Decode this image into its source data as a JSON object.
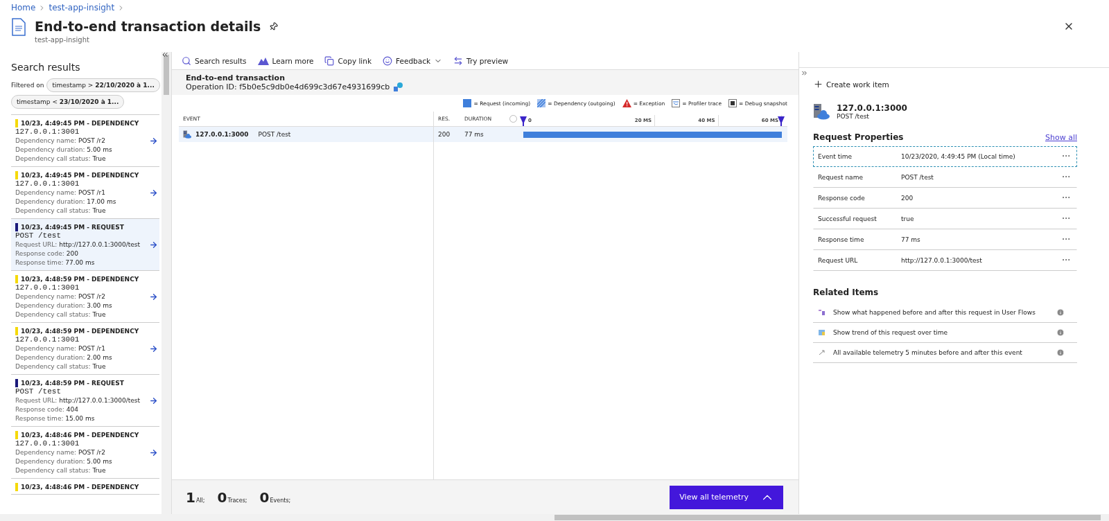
{
  "breadcrumb": [
    "Home",
    "test-app-insight"
  ],
  "title": "End-to-end transaction details",
  "subtitle": "test-app-insight",
  "search_panel": {
    "title": "Search results",
    "filter_label": "Filtered on",
    "filters": [
      {
        "field": "timestamp",
        "op": ">",
        "value": "22/10/2020 à 1..."
      },
      {
        "field": "timestamp",
        "op": "<",
        "value": "23/10/2020 à 1..."
      }
    ],
    "results": [
      {
        "kind": "dependency",
        "selected": false,
        "heading": "10/23, 4:49:45 PM - DEPENDENCY",
        "host": "127.0.0.1:3001",
        "props": [
          [
            "Dependency name:",
            "POST /r2"
          ],
          [
            "Dependency duration:",
            "5.00 ms"
          ],
          [
            "Dependency call status:",
            "True"
          ]
        ]
      },
      {
        "kind": "dependency",
        "selected": false,
        "heading": "10/23, 4:49:45 PM - DEPENDENCY",
        "host": "127.0.0.1:3001",
        "props": [
          [
            "Dependency name:",
            "POST /r1"
          ],
          [
            "Dependency duration:",
            "17.00 ms"
          ],
          [
            "Dependency call status:",
            "True"
          ]
        ]
      },
      {
        "kind": "request",
        "selected": true,
        "heading": "10/23, 4:49:45 PM - REQUEST",
        "host": "POST /test",
        "props": [
          [
            "Request URL:",
            "http://127.0.0.1:3000/test"
          ],
          [
            "Response code:",
            "200"
          ],
          [
            "Response time:",
            "77.00 ms"
          ]
        ]
      },
      {
        "kind": "dependency",
        "selected": false,
        "heading": "10/23, 4:48:59 PM - DEPENDENCY",
        "host": "127.0.0.1:3001",
        "props": [
          [
            "Dependency name:",
            "POST /r2"
          ],
          [
            "Dependency duration:",
            "3.00 ms"
          ],
          [
            "Dependency call status:",
            "True"
          ]
        ]
      },
      {
        "kind": "dependency",
        "selected": false,
        "heading": "10/23, 4:48:59 PM - DEPENDENCY",
        "host": "127.0.0.1:3001",
        "props": [
          [
            "Dependency name:",
            "POST /r1"
          ],
          [
            "Dependency duration:",
            "2.00 ms"
          ],
          [
            "Dependency call status:",
            "True"
          ]
        ]
      },
      {
        "kind": "request",
        "selected": false,
        "heading": "10/23, 4:48:59 PM - REQUEST",
        "host": "POST /test",
        "props": [
          [
            "Request URL:",
            "http://127.0.0.1:3000/test"
          ],
          [
            "Response code:",
            "404"
          ],
          [
            "Response time:",
            "15.00 ms"
          ]
        ]
      },
      {
        "kind": "dependency",
        "selected": false,
        "heading": "10/23, 4:48:46 PM - DEPENDENCY",
        "host": "127.0.0.1:3001",
        "props": [
          [
            "Dependency name:",
            "POST /r2"
          ],
          [
            "Dependency duration:",
            "5.00 ms"
          ],
          [
            "Dependency call status:",
            "True"
          ]
        ]
      },
      {
        "kind": "dependency",
        "selected": false,
        "heading": "10/23, 4:48:46 PM - DEPENDENCY"
      }
    ]
  },
  "toolbar": [
    {
      "kind": "search",
      "label": "Search results"
    },
    {
      "kind": "learn",
      "label": "Learn more"
    },
    {
      "kind": "copy",
      "label": "Copy link"
    },
    {
      "kind": "feedback",
      "label": "Feedback"
    },
    {
      "kind": "preview",
      "label": "Try preview"
    }
  ],
  "transaction": {
    "title": "End-to-end transaction",
    "operation": "Operation ID: f5b0e5c9db0e4d699c3d67e4931699cb",
    "legend": [
      {
        "kind": "request",
        "label": "= Request (incoming)"
      },
      {
        "kind": "dependency",
        "label": "= Dependency (outgoing)"
      },
      {
        "kind": "exception",
        "label": "= Exception"
      },
      {
        "kind": "profiler",
        "label": "= Profiler trace"
      },
      {
        "kind": "snapshot",
        "label": "= Debug snapshot"
      }
    ],
    "columns": [
      "EVENT",
      "RES.",
      "DURATION"
    ],
    "ticks": [
      "0",
      "20 MS",
      "40 MS",
      "60 MS"
    ],
    "rows": [
      {
        "host": "127.0.0.1:3000",
        "name": "POST /test",
        "result": "200",
        "duration": "77 ms",
        "level": 1,
        "selected": true
      }
    ]
  },
  "counts": [
    {
      "value": "1",
      "label": "All;"
    },
    {
      "value": "0",
      "label": "Traces;"
    },
    {
      "value": "0",
      "label": "Events;"
    }
  ],
  "view_all_button": "View all telemetry",
  "details": {
    "create": "Create work item",
    "host": "127.0.0.1:3000",
    "name": "POST /test",
    "properties_title": "Request Properties",
    "show_all": "Show all",
    "properties": [
      {
        "name": "Event time",
        "value": "10/23/2020, 4:49:45 PM (Local time)",
        "selected": true
      },
      {
        "name": "Request name",
        "value": "POST /test",
        "selected": false
      },
      {
        "name": "Response code",
        "value": "200",
        "selected": false
      },
      {
        "name": "Successful request",
        "value": "true",
        "selected": false
      },
      {
        "name": "Response time",
        "value": "77 ms",
        "selected": false
      },
      {
        "name": "Request URL",
        "value": "http://127.0.0.1:3000/test",
        "selected": false
      }
    ],
    "related_title": "Related Items",
    "related": [
      {
        "kind": "flows",
        "label": "Show what happened before and after this request in User Flows"
      },
      {
        "kind": "trend",
        "label": "Show trend of this request over time"
      },
      {
        "kind": "telemetry",
        "label": "All available telemetry 5 minutes before and after this event"
      }
    ]
  }
}
